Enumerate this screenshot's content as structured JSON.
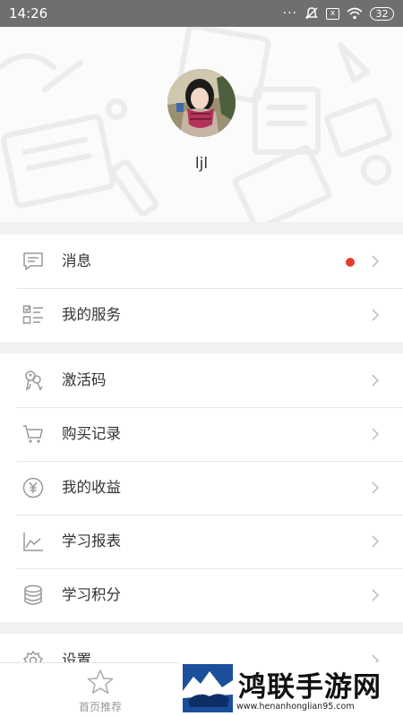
{
  "status_bar": {
    "time": "14:26",
    "dots": "···",
    "sim_text": "x",
    "battery": "32",
    "icons": [
      "mute-icon",
      "sim-icon",
      "wifi-icon",
      "battery-icon"
    ]
  },
  "profile": {
    "username": "ljl"
  },
  "menu_group_1": [
    {
      "label": "消息",
      "icon": "message-icon",
      "has_badge": true
    },
    {
      "label": "我的服务",
      "icon": "service-list-icon"
    }
  ],
  "menu_group_2": [
    {
      "label": "激活码",
      "icon": "key-icon"
    },
    {
      "label": "购买记录",
      "icon": "cart-icon"
    },
    {
      "label": "我的收益",
      "icon": "yen-coin-icon"
    },
    {
      "label": "学习报表",
      "icon": "line-chart-icon"
    },
    {
      "label": "学习积分",
      "icon": "coin-stack-icon"
    }
  ],
  "menu_group_3": [
    {
      "label": "设置",
      "icon": "gear-icon"
    }
  ],
  "bottom_nav": {
    "home_label": "首页推荐",
    "home_icon": "star-icon"
  },
  "watermark": {
    "title": "鸿联手游网",
    "url": "www.henanhonglian95.com"
  },
  "colors": {
    "badge": "#e83a2f",
    "status_bar": "#6f6f6f",
    "icon": "#999999",
    "chevron": "#bbbbbb"
  }
}
